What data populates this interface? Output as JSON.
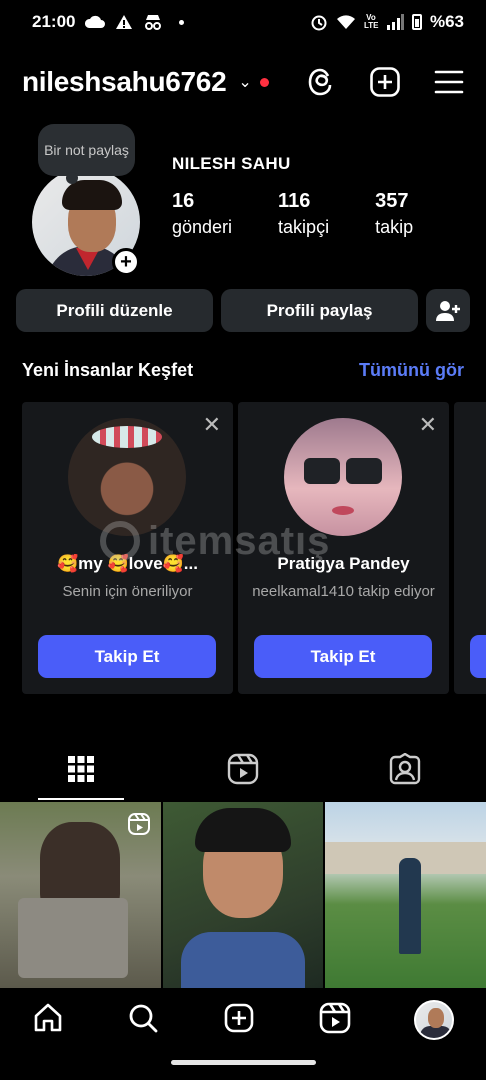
{
  "status_bar": {
    "time": "21:00",
    "battery": "%63",
    "network": "Vo LTE"
  },
  "header": {
    "username": "nileshsahu6762",
    "chevron": "⌄"
  },
  "profile": {
    "note": "Bir not paylaş",
    "full_name": "NILESH SAHU",
    "stats": [
      {
        "value": "16",
        "label": "gönderi"
      },
      {
        "value": "116",
        "label": "takipçi"
      },
      {
        "value": "357",
        "label": "takip"
      }
    ],
    "add_badge": "+"
  },
  "actions": {
    "edit_profile": "Profili düzenle",
    "share_profile": "Profili paylaş"
  },
  "discover": {
    "title": "Yeni İnsanlar Keşfet",
    "see_all": "Tümünü gör",
    "cards": [
      {
        "name": "🥰my 🥰love🥰...",
        "subtitle": "Senin için öneriliyor",
        "follow": "Takip Et"
      },
      {
        "name": "Pratigya Pandey",
        "subtitle": "neelkamal1410 takip ediyor",
        "follow": "Takip Et"
      }
    ]
  },
  "watermark": "itemsatış",
  "colors": {
    "background": "#000000",
    "button_bg": "#262a2e",
    "accent_link": "#5b7cf7",
    "follow_btn": "#4a5df9",
    "notification_dot": "#ff3040"
  },
  "icons": {
    "threads": "threads-icon",
    "new_post": "plus-square-icon",
    "menu": "hamburger-menu-icon",
    "add_person": "person-add-icon",
    "grid_tab": "grid-icon",
    "reels_tab": "reels-icon",
    "tagged_tab": "tagged-person-icon",
    "nav": [
      "home-icon",
      "search-icon",
      "create-icon",
      "reels-icon",
      "profile-avatar"
    ]
  }
}
